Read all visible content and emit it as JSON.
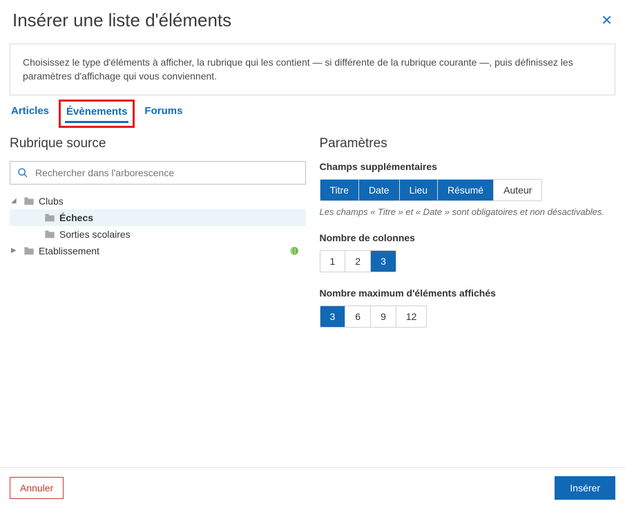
{
  "title": "Insérer une liste d'éléments",
  "info": "Choisissez le type d'éléments à afficher, la rubrique qui les contient — si différente de la rubrique courante —, puis définissez les paramètres d'affichage qui vous conviennent.",
  "tabs": {
    "articles": "Articles",
    "evenements": "Évènements",
    "forums": "Forums"
  },
  "source": {
    "title": "Rubrique source",
    "search_placeholder": "Rechercher dans l'arborescence",
    "tree": {
      "clubs": "Clubs",
      "echecs": "Échecs",
      "sorties": "Sorties scolaires",
      "etablissement": "Etablissement"
    }
  },
  "params": {
    "title": "Paramètres",
    "fields": {
      "label": "Champs supplémentaires",
      "titre": "Titre",
      "date": "Date",
      "lieu": "Lieu",
      "resume": "Résumé",
      "auteur": "Auteur",
      "hint": "Les champs « Titre » et « Date » sont obligatoires et non désactivables."
    },
    "columns": {
      "label": "Nombre de colonnes",
      "opt1": "1",
      "opt2": "2",
      "opt3": "3"
    },
    "max": {
      "label": "Nombre maximum d'éléments affichés",
      "opt3": "3",
      "opt6": "6",
      "opt9": "9",
      "opt12": "12"
    }
  },
  "footer": {
    "cancel": "Annuler",
    "insert": "Insérer"
  }
}
